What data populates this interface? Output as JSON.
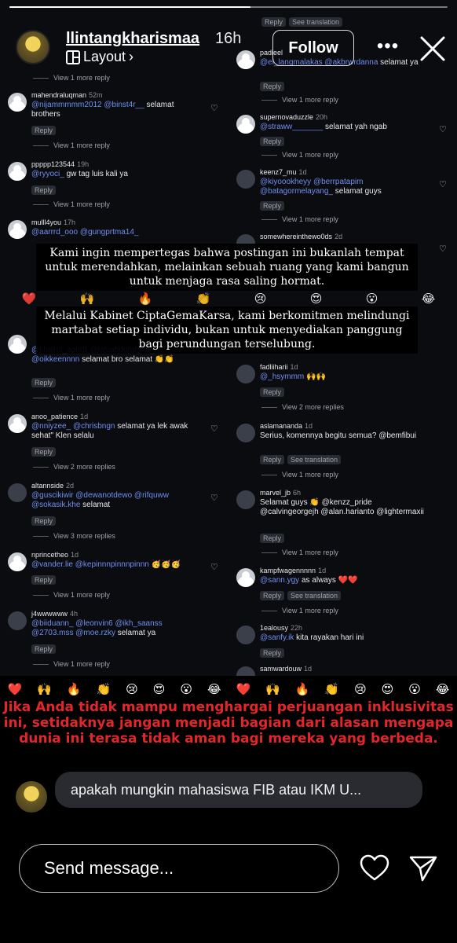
{
  "story": {
    "username": "llintangkharismaa",
    "time": "16h",
    "layout_label": "Layout",
    "follow_label": "Follow",
    "progress": 0.55,
    "more_glyph": "•••"
  },
  "overlay": {
    "box1": "Kami ingin mempertegas bahwa postingan ini bukanlah tempat untuk merendahkan, melainkan sebuah ruang yang kami bangun untuk menjaga rasa saling hormat.",
    "box2": "Melalui Kabinet CiptaGemaKarsa, kami berkomitmen melindungi martabat setiap individu, bukan untuk menyediakan panggung bagi perundungan terselubung."
  },
  "warning": "Jika Anda tidak mampu menghargai perjuangan inklusivitas ini, setidaknya jangan menjadi bagian dari alasan mengapa dunia ini terasa tidak aman bagi mereka yang berbeda.",
  "emoji_row": [
    "❤️",
    "🙌",
    "🔥",
    "👏",
    "😢",
    "😍",
    "😮",
    "😂"
  ],
  "reply_label": "Reply",
  "see_translation_label": "See translation",
  "left_comments": [
    {
      "user": "mahendraluqman",
      "time": "52m",
      "mentions": "@nijammmmm2012 @binst4r__",
      "text": " selamat brothers",
      "more": "View 1 more reply"
    },
    {
      "user": "ppppp123544",
      "time": "19h",
      "mentions": "@ryyoci_",
      "text": " gw tag luis kali ya",
      "more": "View 1 more reply"
    },
    {
      "user": "mulll4you",
      "time": "17h",
      "mentions": "@aarrrd_ooo @gungprtma14_",
      "text": "",
      "more": ""
    },
    {
      "user": "",
      "time": "",
      "mentions": "@khairul_apndii @laluabdurahma_n @oikkeennnn",
      "text": " selamat bro selamat 👏👏",
      "more": "View 1 more reply"
    },
    {
      "user": "anoo_patience",
      "time": "1d",
      "mentions": "@nniyzee_ @chrisbngn",
      "text": " selamat ya lek awak sehat\" Klen selalu",
      "more": "View 2 more replies"
    },
    {
      "user": "altannside",
      "time": "2d",
      "mentions": "@guscikiwir @dewanotdewo @rifquww @sokasik.khe",
      "text": " selamat",
      "more": "View 3 more replies"
    },
    {
      "user": "nprincetheo",
      "time": "1d",
      "mentions": "@vander.lie @kepinnnpinnnpinnn",
      "text": " 🥳🥳🥳",
      "more": "View 1 more reply"
    },
    {
      "user": "j4wwwwww",
      "time": "4h",
      "mentions": "@biiduann_ @leonvin6 @ikh_saanss @2703.mss @moe.rzky",
      "text": " selamat ya",
      "more": "View 1 more reply"
    }
  ],
  "right_comments": [
    {
      "user": "padieel",
      "time": "",
      "mentions": "@el_langmalakas @akbrwrdanna",
      "text": " selamat ya",
      "more": "View 1 more reply"
    },
    {
      "user": "supernovaduzzle",
      "time": "20h",
      "mentions": "@straww_______",
      "text": " selamat yah ngab",
      "more": "View 1 more reply"
    },
    {
      "user": "keenz7_mu",
      "time": "1d",
      "mentions": "@kiyoookheyy @berrpatapim @batagormelayang_",
      "text": " selamat guys",
      "more": "View 1 more reply"
    },
    {
      "user": "somewhereinthewo0ds",
      "time": "2d",
      "mentions": "",
      "text": "",
      "more": ""
    },
    {
      "user": "fadliiharii",
      "time": "1d",
      "mentions": "@_hsymmm",
      "text": " 🙌🙌",
      "more": "View 2 more replies"
    },
    {
      "user": "aslamananda",
      "time": "1d",
      "mentions": "",
      "text": "Serius, komennya begitu semua? @bemfibui",
      "more": "View 1 more reply"
    },
    {
      "user": "marvel_jb",
      "time": "6h",
      "mentions": "",
      "text": "Selamat guys 👏 @kenzz_pride @calvingeorgejh @alan.harianto @lightermaxii",
      "more": "View 1 more reply"
    },
    {
      "user": "kampfwagennnnn",
      "time": "1d",
      "mentions": "@sann.ygy",
      "text": " as always ❤️❤️",
      "more": "View 1 more reply"
    },
    {
      "user": "1ealousy",
      "time": "22h",
      "mentions": "@sanfy.ik",
      "text": " kita rayakan hari ini",
      "more": ""
    },
    {
      "user": "samwardouw",
      "time": "1d",
      "mentions": "",
      "text": "",
      "more": ""
    }
  ],
  "comment_preview": "apakah mungkin mahasiswa FIB atau IKM U...",
  "send_placeholder": "Send message..."
}
